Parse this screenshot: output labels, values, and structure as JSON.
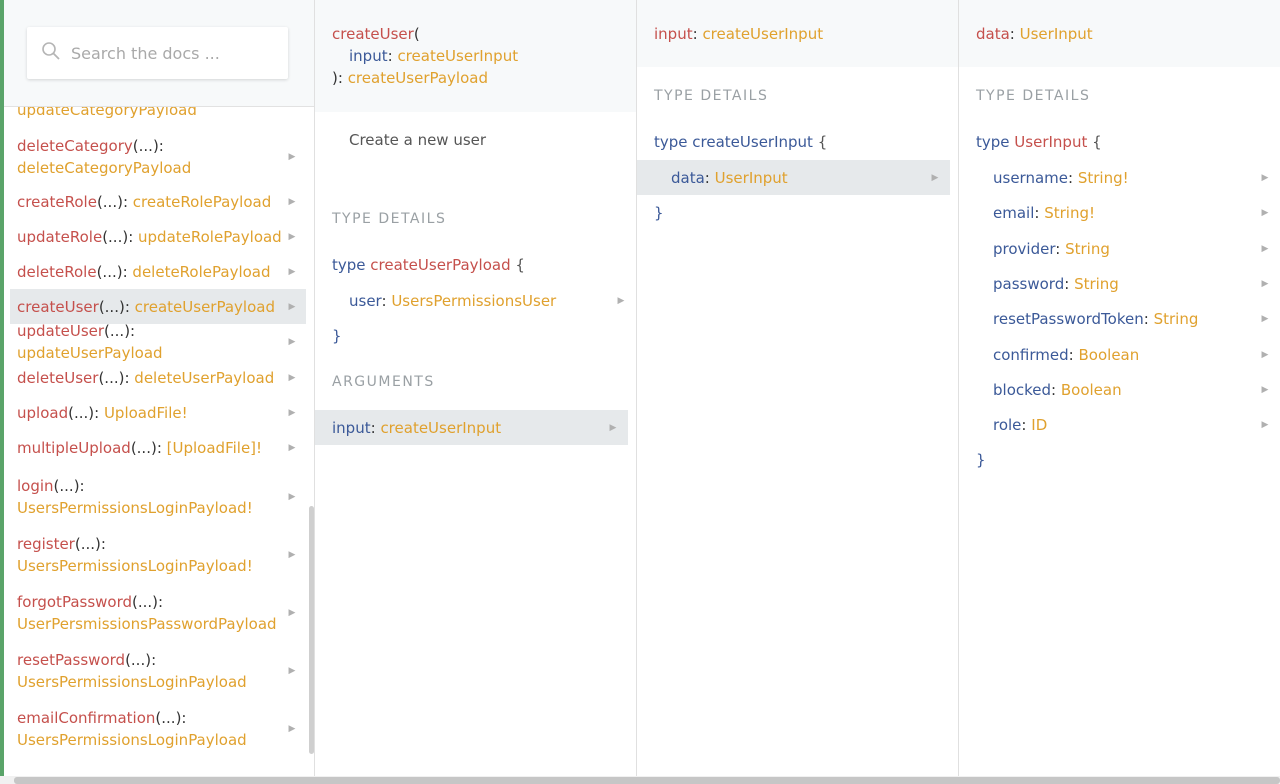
{
  "search": {
    "placeholder": "Search the docs ..."
  },
  "mutations": [
    {
      "name": "",
      "args": "",
      "type": "updateCategoryPayload"
    },
    {
      "name": "deleteCategory",
      "args": "(...):",
      "type": "deleteCategoryPayload"
    },
    {
      "name": "createRole",
      "args": "(...):",
      "type": "createRolePayload"
    },
    {
      "name": "updateRole",
      "args": "(...):",
      "type": "updateRolePayload"
    },
    {
      "name": "deleteRole",
      "args": "(...):",
      "type": "deleteRolePayload"
    },
    {
      "name": "createUser",
      "args": "(...):",
      "type": "createUserPayload"
    },
    {
      "name": "updateUser",
      "args": "(...):",
      "type": "updateUserPayload"
    },
    {
      "name": "deleteUser",
      "args": "(...):",
      "type": "deleteUserPayload"
    },
    {
      "name": "upload",
      "args": "(...):",
      "type": "UploadFile!"
    },
    {
      "name": "multipleUpload",
      "args": "(...):",
      "type": "[UploadFile]!"
    },
    {
      "name": "login",
      "args": "(...):",
      "type": "UsersPermissionsLoginPayload!"
    },
    {
      "name": "register",
      "args": "(...):",
      "type": "UsersPermissionsLoginPayload!"
    },
    {
      "name": "forgotPassword",
      "args": "(...):",
      "type": "UserPersmissionsPasswordPayload"
    },
    {
      "name": "resetPassword",
      "args": "(...):",
      "type": "UsersPermissionsLoginPayload"
    },
    {
      "name": "emailConfirmation",
      "args": "(...):",
      "type": "UsersPermissionsLoginPayload"
    }
  ],
  "detail": {
    "header": {
      "name": "createUser",
      "open": "(",
      "arg_name": "input",
      "arg_sep": ":",
      "arg_type": "createUserInput",
      "close": "):",
      "return_type": "createUserPayload"
    },
    "description": "Create a new user",
    "type_details_title": "TYPE DETAILS",
    "type_kw": "type",
    "type_name": "createUserPayload",
    "brace_open": "{",
    "brace_close": "}",
    "fields": [
      {
        "name": "user",
        "sep": ":",
        "type": "UsersPermissionsUser"
      }
    ],
    "arguments_title": "ARGUMENTS",
    "arguments": [
      {
        "name": "input",
        "sep": ":",
        "type": "createUserInput"
      }
    ]
  },
  "input_panel": {
    "header_name": "input",
    "header_sep": ":",
    "header_type": "createUserInput",
    "title": "TYPE DETAILS",
    "type_kw": "type",
    "type_name": "createUserInput",
    "brace_open": "{",
    "brace_close": "}",
    "fields": [
      {
        "name": "data",
        "sep": ":",
        "type": "UserInput"
      }
    ]
  },
  "data_panel": {
    "header_name": "data",
    "header_sep": ":",
    "header_type": "UserInput",
    "title": "TYPE DETAILS",
    "type_kw": "type",
    "type_name": "UserInput",
    "brace_open": "{",
    "brace_close": "}",
    "fields": [
      {
        "name": "username",
        "sep": ":",
        "type": "String!"
      },
      {
        "name": "email",
        "sep": ":",
        "type": "String!"
      },
      {
        "name": "provider",
        "sep": ":",
        "type": "String"
      },
      {
        "name": "password",
        "sep": ":",
        "type": "String"
      },
      {
        "name": "resetPasswordToken",
        "sep": ":",
        "type": "String"
      },
      {
        "name": "confirmed",
        "sep": ":",
        "type": "Boolean"
      },
      {
        "name": "blocked",
        "sep": ":",
        "type": "Boolean"
      },
      {
        "name": "role",
        "sep": ":",
        "type": "ID"
      }
    ]
  },
  "icons": {
    "search": "search-icon",
    "arrow": "triangle-right-icon"
  },
  "colors": {
    "field": "#c5504c",
    "type": "#e0a12e",
    "keyword": "#3b5998",
    "accent": "#5aa469"
  }
}
